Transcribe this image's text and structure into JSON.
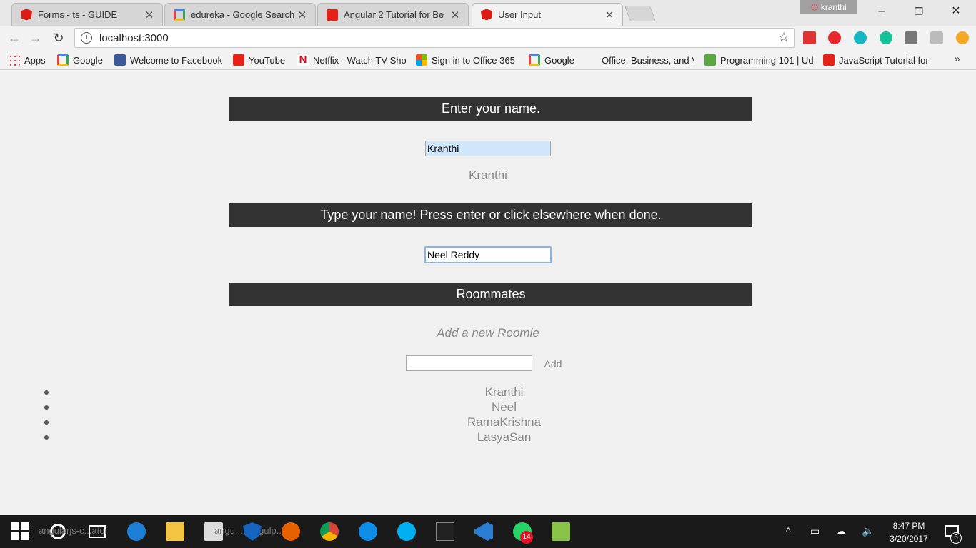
{
  "tabs": [
    {
      "title": "Forms - ts - GUIDE",
      "icon": "angular-icon"
    },
    {
      "title": "edureka - Google Search",
      "icon": "google-icon"
    },
    {
      "title": "Angular 2 Tutorial for Be",
      "icon": "youtube-icon"
    },
    {
      "title": "User Input",
      "icon": "angular-icon"
    }
  ],
  "profile_name": "kranthi",
  "window_controls": {
    "minimize": "–",
    "maximize": "❐",
    "close": "✕"
  },
  "address": "localhost:3000",
  "bookmarks": [
    {
      "label": "Apps",
      "icon": "apps-icon"
    },
    {
      "label": "Google",
      "icon": "google-icon"
    },
    {
      "label": "Welcome to Facebook",
      "icon": "facebook-icon"
    },
    {
      "label": "YouTube",
      "icon": "youtube-icon"
    },
    {
      "label": "Netflix - Watch TV Sho",
      "icon": "netflix-icon"
    },
    {
      "label": "Sign in to Office 365",
      "icon": "microsoft-icon"
    },
    {
      "label": "Google",
      "icon": "google-icon"
    },
    {
      "label": "Office, Business, and V",
      "icon": "blank-icon"
    },
    {
      "label": "Programming 101 | Ud",
      "icon": "udemy-icon"
    },
    {
      "label": "JavaScript Tutorial for",
      "icon": "youtube-icon"
    }
  ],
  "page": {
    "section1_title": "Enter your name.",
    "name_input_value": "Kranthi",
    "name_echo": "Kranthi",
    "section2_title": "Type your name! Press enter or click elsewhere when done.",
    "name2_input_value": "Neel Reddy",
    "section3_title": "Roommates",
    "add_roomie_label": "Add a new Roomie",
    "add_input_value": "",
    "add_button": "Add",
    "roommates": [
      "Kranthi",
      "Neel",
      "RamaKrishna",
      "LasyaSan"
    ]
  },
  "taskbar": {
    "ghost_left": "angularjs-c...ator",
    "ghost_mid": "angu... -angulp...",
    "whatsapp_badge": "14",
    "clock_time": "8:47 PM",
    "clock_date": "3/20/2017",
    "notification_count": "6"
  },
  "colors": {
    "header_bar": "#333333",
    "page_bg": "#f0f0f0",
    "muted_text": "#888888"
  }
}
